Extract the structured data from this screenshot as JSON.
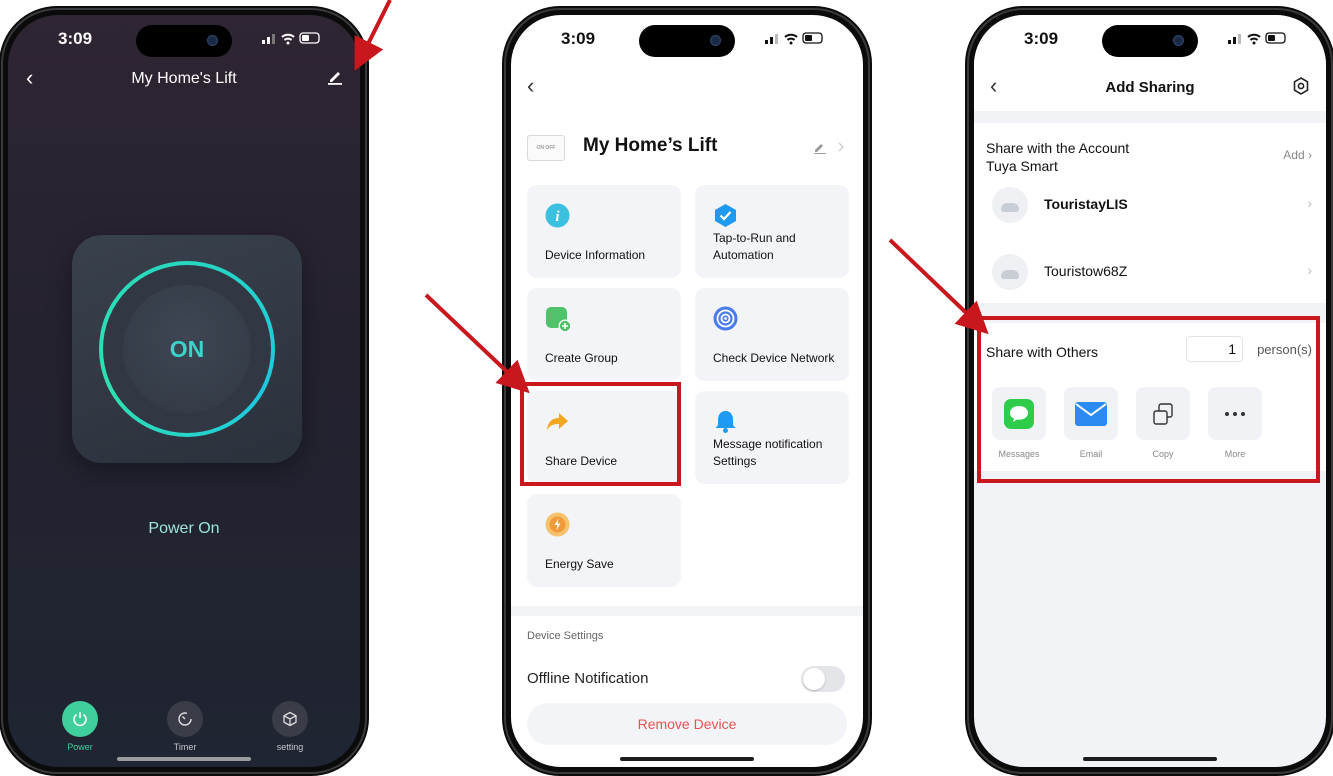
{
  "status_time": "3:09",
  "phone1": {
    "title": "My Home's Lift",
    "power_label": "ON",
    "status": "Power On",
    "tabs": [
      {
        "label": "Power",
        "icon": "power-icon"
      },
      {
        "label": "Timer",
        "icon": "timer-icon"
      },
      {
        "label": "setting",
        "icon": "settings-cube-icon"
      }
    ],
    "colors": {
      "accent": "#3fcf9c",
      "ring": "#27d8c0"
    }
  },
  "phone2": {
    "device_name": "My Home’s Lift",
    "device_thumb_text": "ON OFF",
    "tiles": [
      {
        "label": "Device Information",
        "icon": "info-icon"
      },
      {
        "label": "Tap-to-Run and Automation",
        "icon": "automation-check-icon"
      },
      {
        "label": "Create Group",
        "icon": "create-group-icon"
      },
      {
        "label": "Check Device Network",
        "icon": "network-icon"
      },
      {
        "label": "Share Device",
        "icon": "share-arrow-icon"
      },
      {
        "label": "Message notification Settings",
        "icon": "bell-icon"
      },
      {
        "label": "Energy Save",
        "icon": "energy-icon"
      }
    ],
    "section_label": "Device Settings",
    "offline_label": "Offline Notification",
    "remove_label": "Remove Device",
    "colors": {
      "remove": "#e55353"
    }
  },
  "phone3": {
    "title": "Add Sharing",
    "account_title_line1": "Share with the Account",
    "account_title_line2": "Tuya Smart",
    "add_label": "Add",
    "users": [
      "TouristayLIS",
      "Touristow68Z"
    ],
    "others_title": "Share with Others",
    "count_value": "1",
    "count_unit": "person(s)",
    "share_options": [
      {
        "label": "Messages",
        "icon": "messages-icon"
      },
      {
        "label": "Email",
        "icon": "mail-icon"
      },
      {
        "label": "Copy",
        "icon": "copy-icon"
      },
      {
        "label": "More",
        "icon": "more-dots-icon"
      }
    ]
  },
  "annotation_color": "#c8181d"
}
